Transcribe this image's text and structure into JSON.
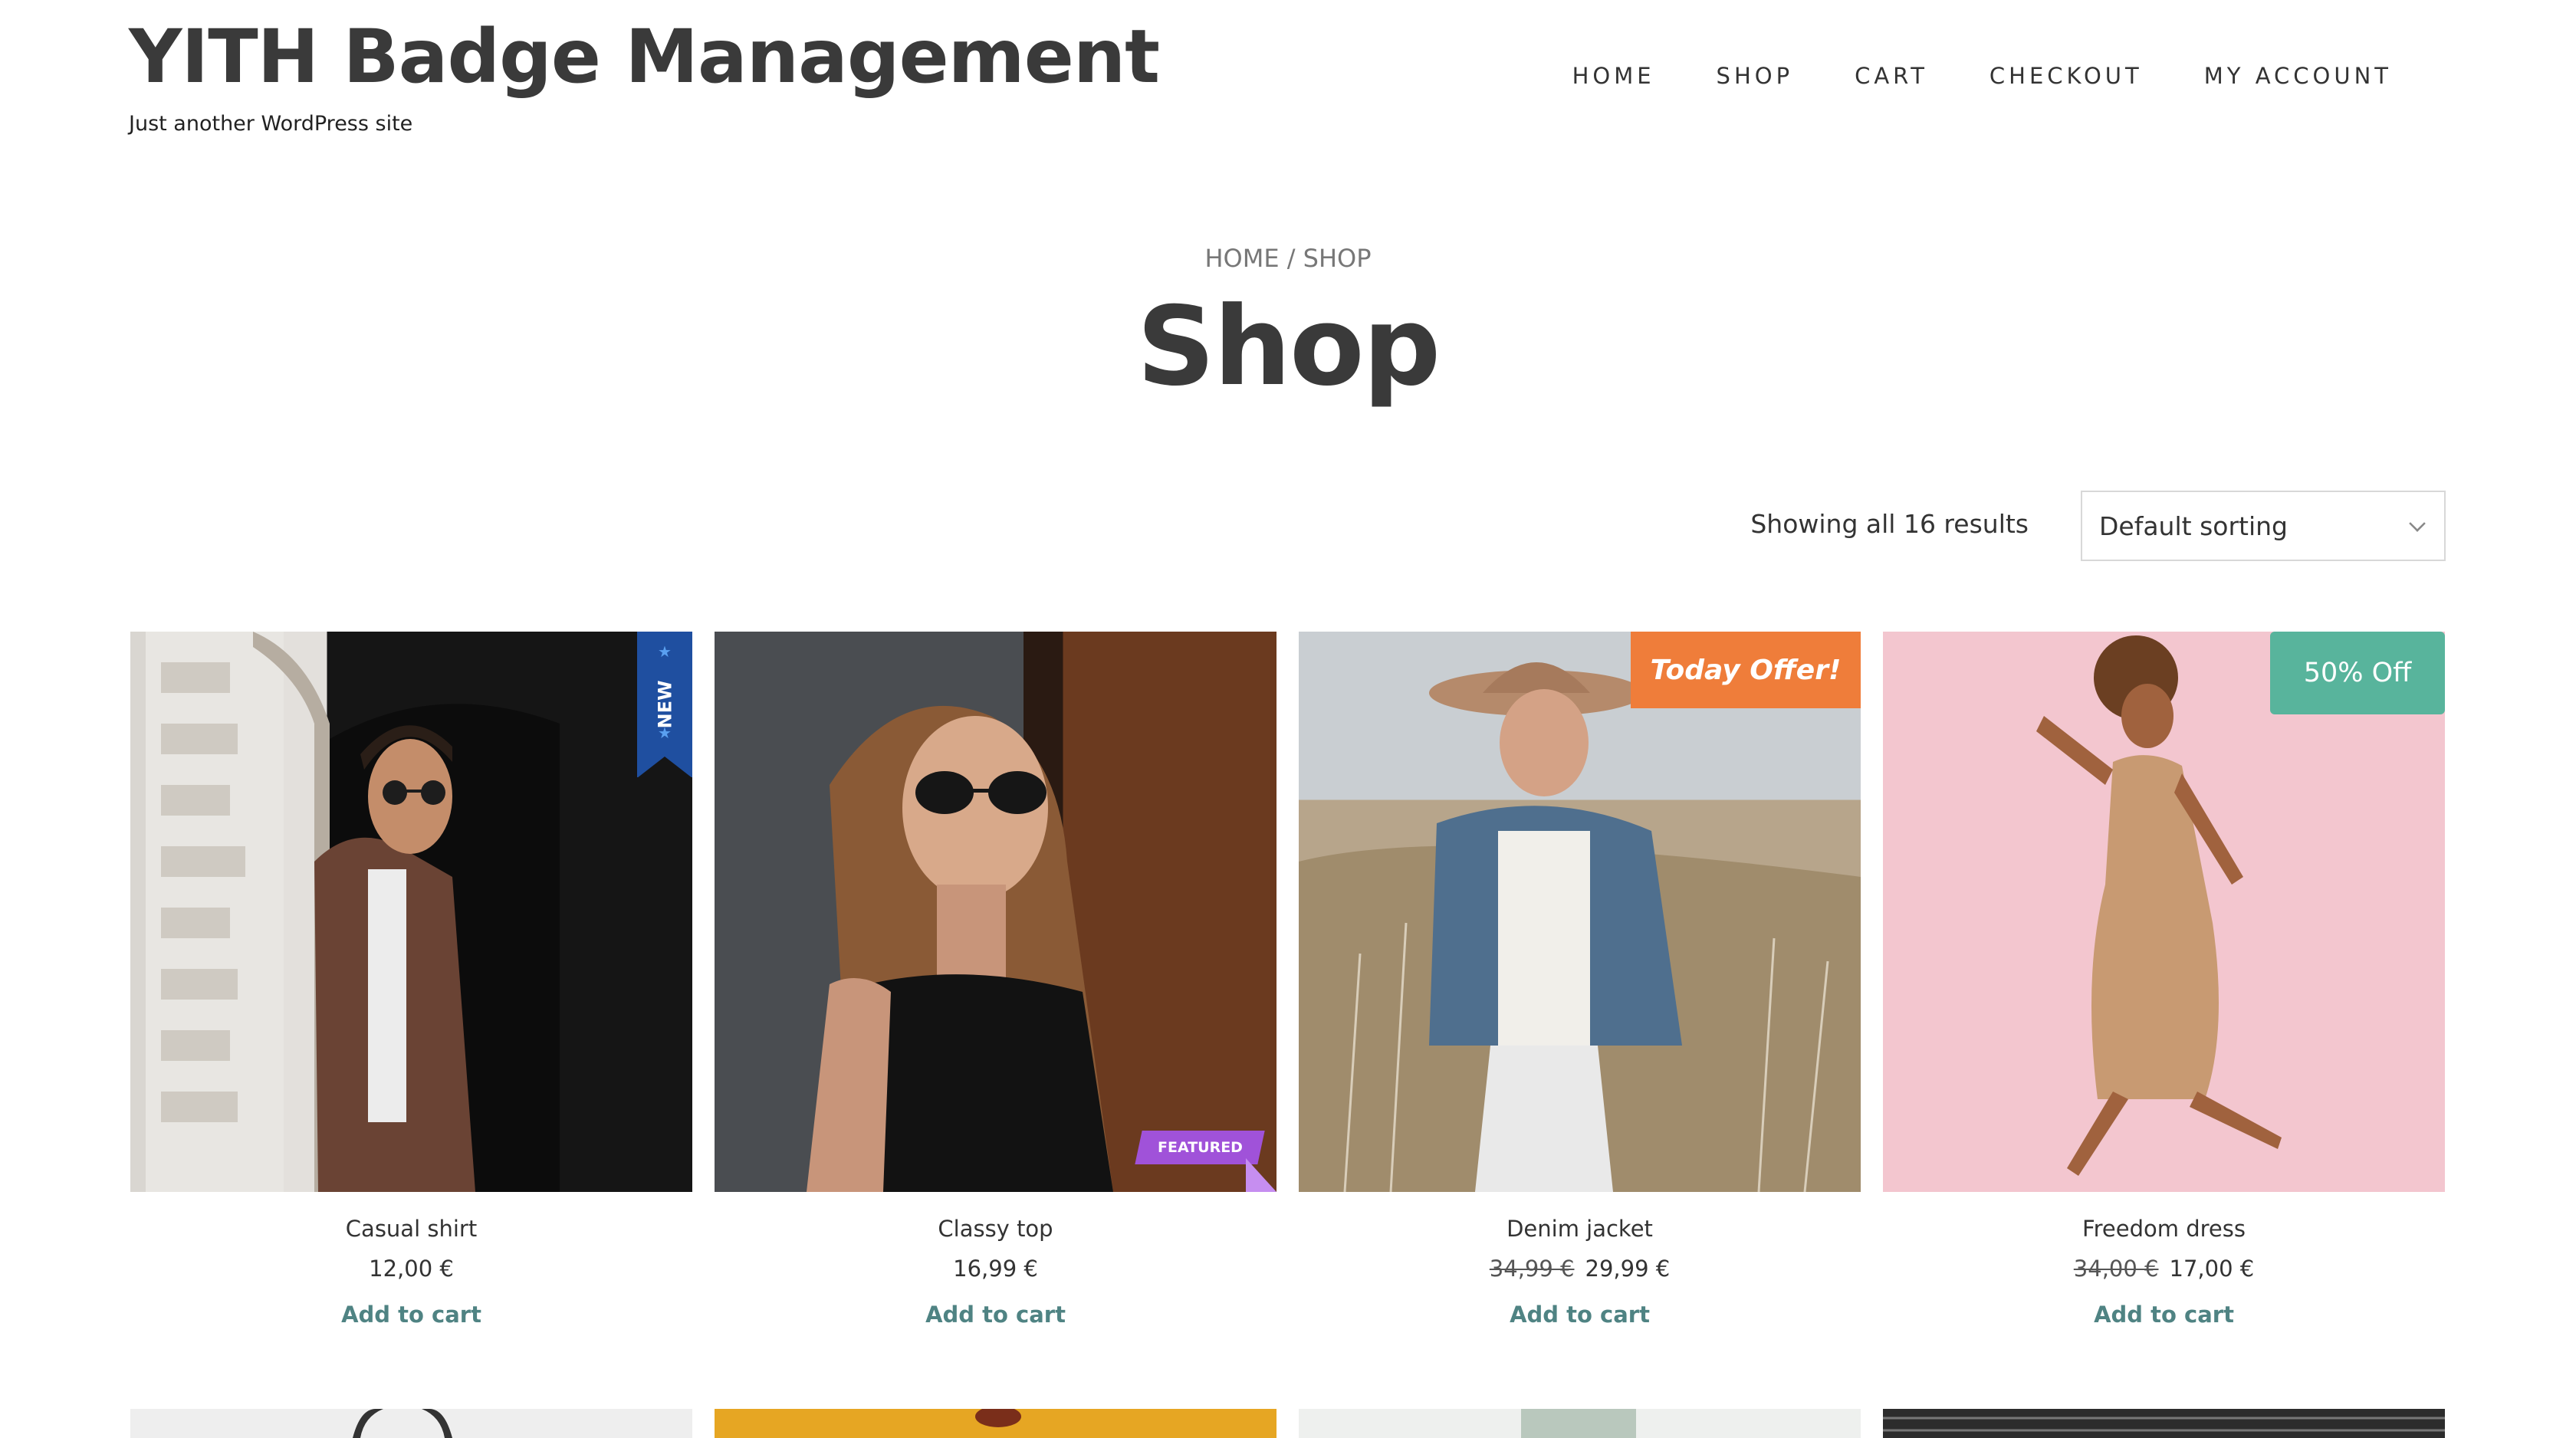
{
  "header": {
    "site_title": "YITH Badge Management",
    "tagline": "Just another WordPress site"
  },
  "nav": {
    "items": [
      "HOME",
      "SHOP",
      "CART",
      "CHECKOUT",
      "MY ACCOUNT"
    ]
  },
  "breadcrumb": {
    "home": "HOME",
    "separator": " / ",
    "current": "SHOP"
  },
  "page": {
    "title": "Shop",
    "result_count": "Showing all 16 results",
    "sort_selected": "Default sorting"
  },
  "products": [
    {
      "name": "Casual shirt",
      "price": "12,00 €",
      "old_price": "",
      "add_label": "Add to cart",
      "badge": "NEW"
    },
    {
      "name": "Classy top",
      "price": "16,99 €",
      "old_price": "",
      "add_label": "Add to cart",
      "badge": "FEATURED"
    },
    {
      "name": "Denim jacket",
      "price": "29,99 €",
      "old_price": "34,99 €",
      "add_label": "Add to cart",
      "badge": "Today Offer!"
    },
    {
      "name": "Freedom dress",
      "price": "17,00 €",
      "old_price": "34,00 €",
      "add_label": "Add to cart",
      "badge": "50% Off"
    }
  ],
  "colors": {
    "accent_link": "#4f8383",
    "badge_new": "#1f4fa0",
    "badge_featured": "#a052d9",
    "badge_offer": "#ef7d3a",
    "badge_off": "#58b49c"
  }
}
